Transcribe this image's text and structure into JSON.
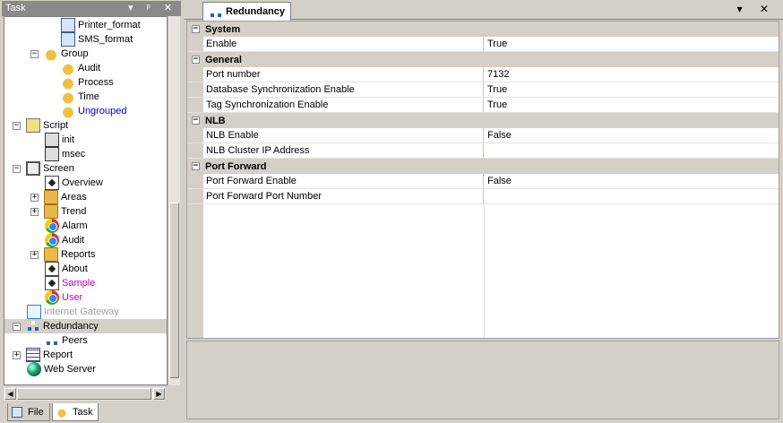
{
  "task_panel": {
    "title": "Task",
    "controls": "▾ ᵖ ✕"
  },
  "tree": [
    {
      "label": "Printer_format",
      "icon": "format-icon",
      "indent": 3,
      "color": "#000"
    },
    {
      "label": "SMS_format",
      "icon": "format-icon",
      "indent": 3,
      "color": "#000"
    },
    {
      "label": "Group",
      "icon": "bell-icon",
      "indent": 2,
      "expander": "−",
      "color": "#000"
    },
    {
      "label": "Audit",
      "icon": "bell-icon",
      "indent": 3,
      "color": "#000"
    },
    {
      "label": "Process",
      "icon": "bell-icon",
      "indent": 3,
      "color": "#000"
    },
    {
      "label": "Time",
      "icon": "bell-icon",
      "indent": 3,
      "color": "#000"
    },
    {
      "label": "Ungrouped",
      "icon": "bell-icon",
      "indent": 3,
      "color": "#0000c0"
    },
    {
      "label": "Script",
      "icon": "script-icon",
      "indent": 1,
      "expander": "−",
      "color": "#000"
    },
    {
      "label": "init",
      "icon": "script-file-icon",
      "indent": 2,
      "color": "#000"
    },
    {
      "label": "msec",
      "icon": "script-file-icon",
      "indent": 2,
      "color": "#000"
    },
    {
      "label": "Screen",
      "icon": "screen-icon",
      "indent": 1,
      "expander": "−",
      "color": "#000"
    },
    {
      "label": "Overview",
      "icon": "document-icon",
      "indent": 2,
      "color": "#000"
    },
    {
      "label": "Areas",
      "icon": "folder-icon",
      "indent": 2,
      "expander": "+",
      "color": "#000"
    },
    {
      "label": "Trend",
      "icon": "folder-icon",
      "indent": 2,
      "expander": "+",
      "color": "#000"
    },
    {
      "label": "Alarm",
      "icon": "chrome-icon",
      "indent": 2,
      "color": "#000"
    },
    {
      "label": "Audit",
      "icon": "chrome-icon",
      "indent": 2,
      "color": "#000"
    },
    {
      "label": "Reports",
      "icon": "folder-icon",
      "indent": 2,
      "expander": "+",
      "color": "#000"
    },
    {
      "label": "About",
      "icon": "document-icon",
      "indent": 2,
      "color": "#000"
    },
    {
      "label": "Sample",
      "icon": "document-icon",
      "indent": 2,
      "color": "#c000c0"
    },
    {
      "label": "User",
      "icon": "chrome-icon",
      "indent": 2,
      "color": "#c000c0"
    },
    {
      "label": "Internet Gateway",
      "icon": "gateway-icon",
      "indent": 1,
      "color": "#a0a0a0"
    },
    {
      "label": "Redundancy",
      "icon": "network-icon",
      "indent": 1,
      "expander": "−",
      "color": "#000",
      "selected": true
    },
    {
      "label": "Peers",
      "icon": "network-icon",
      "indent": 2,
      "color": "#000"
    },
    {
      "label": "Report",
      "icon": "grid-icon",
      "indent": 1,
      "expander": "+",
      "color": "#000"
    },
    {
      "label": "Web Server",
      "icon": "globe-icon",
      "indent": 1,
      "color": "#000"
    }
  ],
  "bottom_tabs": [
    {
      "label": "File",
      "active": false
    },
    {
      "label": "Task",
      "active": true
    }
  ],
  "editor": {
    "tab_label": "Redundancy",
    "controls": "▾ ✕"
  },
  "properties": [
    {
      "category": "System",
      "rows": [
        {
          "name": "Enable",
          "value": "True"
        }
      ]
    },
    {
      "category": "General",
      "rows": [
        {
          "name": "Port number",
          "value": "7132"
        },
        {
          "name": "Database Synchronization Enable",
          "value": "True"
        },
        {
          "name": "Tag Synchronization Enable",
          "value": "True"
        }
      ]
    },
    {
      "category": "NLB",
      "rows": [
        {
          "name": "NLB Enable",
          "value": "False"
        },
        {
          "name": "NLB Cluster IP Address",
          "value": ""
        }
      ]
    },
    {
      "category": "Port Forward",
      "rows": [
        {
          "name": "Port Forward Enable",
          "value": "False"
        },
        {
          "name": "Port Forward Port Number",
          "value": ""
        }
      ]
    }
  ]
}
